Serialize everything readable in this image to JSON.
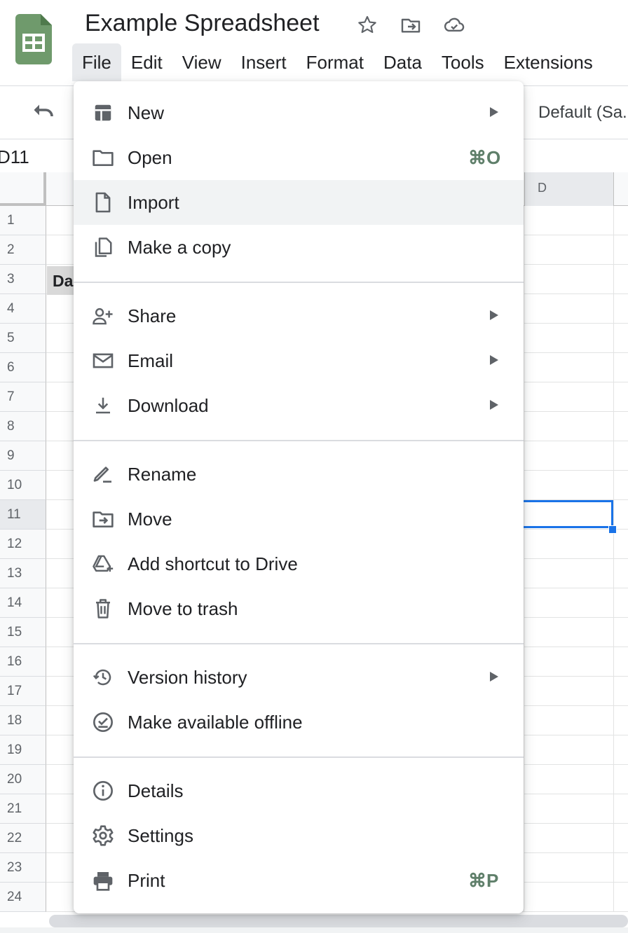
{
  "header": {
    "title": "Example Spreadsheet",
    "icons": [
      "star-icon",
      "move-folder-icon",
      "cloud-saved-icon"
    ],
    "logo_color": "#6f9a6c"
  },
  "menubar": {
    "items": [
      "File",
      "Edit",
      "View",
      "Insert",
      "Format",
      "Data",
      "Tools",
      "Extensions"
    ],
    "active": "File"
  },
  "toolbar": {
    "font": "Default (Sa..."
  },
  "formula_bar": {
    "name_box": "D11"
  },
  "sheet": {
    "column_header": "D",
    "row_numbers": [
      "1",
      "2",
      "3",
      "4",
      "5",
      "6",
      "7",
      "8",
      "9",
      "10",
      "11",
      "12",
      "13",
      "14",
      "15",
      "16",
      "17",
      "18",
      "19",
      "20",
      "21",
      "22",
      "23",
      "24"
    ],
    "selected_row": "11",
    "cell_A3_text": "Da"
  },
  "file_menu": {
    "items": [
      {
        "label": "New",
        "icon": "new-spreadsheet-icon",
        "submenu": true
      },
      {
        "label": "Open",
        "icon": "folder-icon",
        "shortcut": "⌘O"
      },
      {
        "label": "Import",
        "icon": "file-icon",
        "highlighted": true
      },
      {
        "label": "Make a copy",
        "icon": "copy-icon"
      },
      {
        "label": "Share",
        "icon": "person-add-icon",
        "submenu": true
      },
      {
        "label": "Email",
        "icon": "mail-icon",
        "submenu": true
      },
      {
        "label": "Download",
        "icon": "download-icon",
        "submenu": true
      },
      {
        "label": "Rename",
        "icon": "rename-icon"
      },
      {
        "label": "Move",
        "icon": "move-folder-icon"
      },
      {
        "label": "Add shortcut to Drive",
        "icon": "drive-shortcut-icon"
      },
      {
        "label": "Move to trash",
        "icon": "trash-icon"
      },
      {
        "label": "Version history",
        "icon": "history-icon",
        "submenu": true
      },
      {
        "label": "Make available offline",
        "icon": "offline-check-icon"
      },
      {
        "label": "Details",
        "icon": "info-icon"
      },
      {
        "label": "Settings",
        "icon": "gear-icon"
      },
      {
        "label": "Print",
        "icon": "printer-icon",
        "shortcut": "⌘P"
      }
    ]
  },
  "colors": {
    "accent": "#1a73e8",
    "shortcut": "#5f7f6a",
    "highlight": "#f1f3f4"
  }
}
